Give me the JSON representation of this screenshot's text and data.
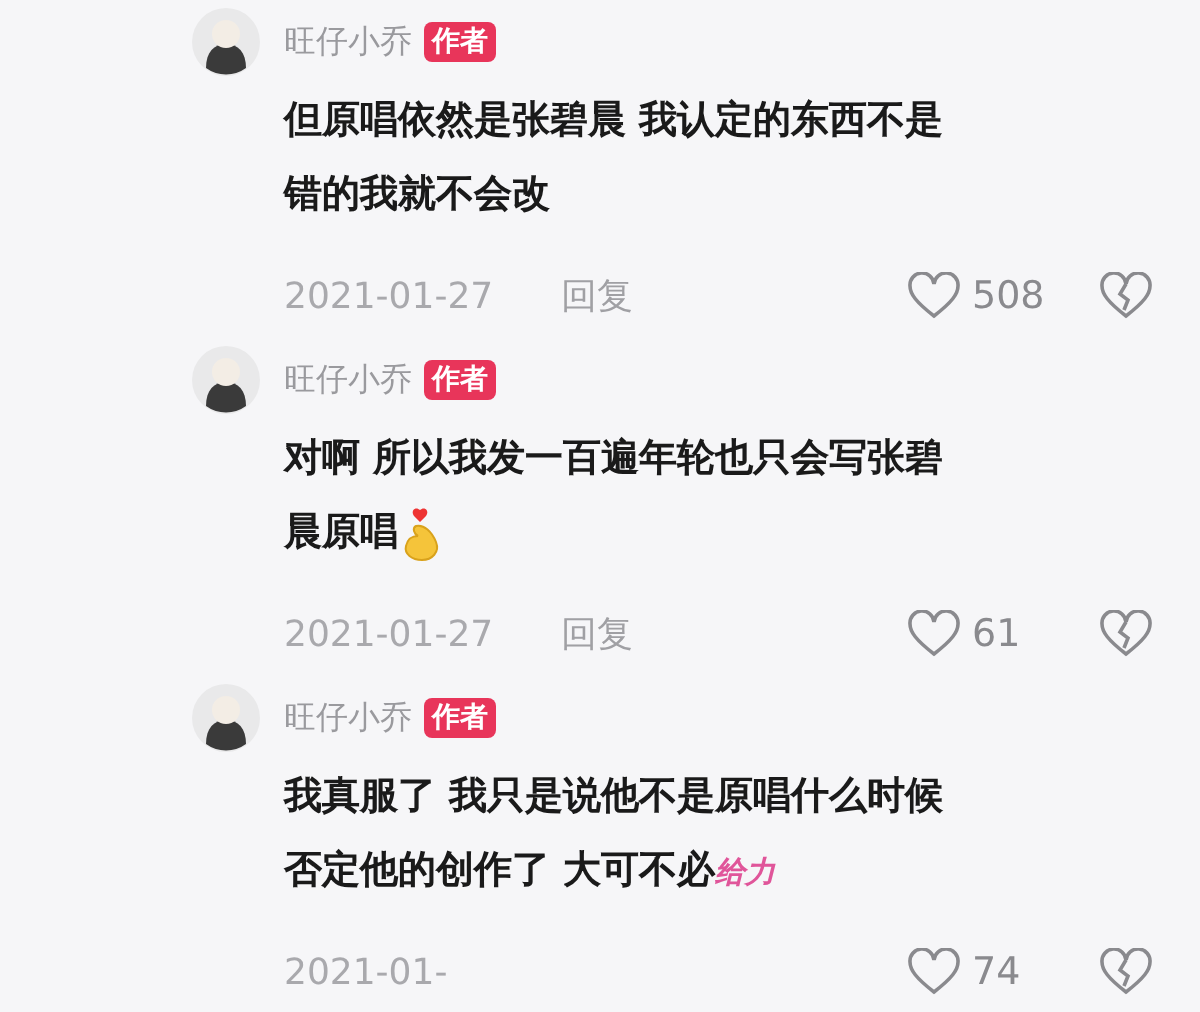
{
  "comments": [
    {
      "author": "旺仔小乔",
      "badge": "作者",
      "body": [
        {
          "kind": "text",
          "text": "但原唱依然是张碧晨 我认定的东西不是错的我就不会改"
        }
      ],
      "date": "2021-01-27",
      "reply": "回复",
      "likes": "508"
    },
    {
      "author": "旺仔小乔",
      "badge": "作者",
      "body": [
        {
          "kind": "text",
          "text": "对啊 所以我发一百遍年轮也只会写张碧晨原唱"
        },
        {
          "kind": "emoji"
        }
      ],
      "date": "2021-01-27",
      "reply": "回复",
      "likes": "61"
    },
    {
      "author": "旺仔小乔",
      "badge": "作者",
      "body": [
        {
          "kind": "text",
          "text": "我真服了 我只是说他不是原唱什么时候否定他的创作了 大可不必"
        },
        {
          "kind": "sticker",
          "text": "给力"
        }
      ],
      "date": "2021-01-",
      "likes": "74"
    }
  ]
}
